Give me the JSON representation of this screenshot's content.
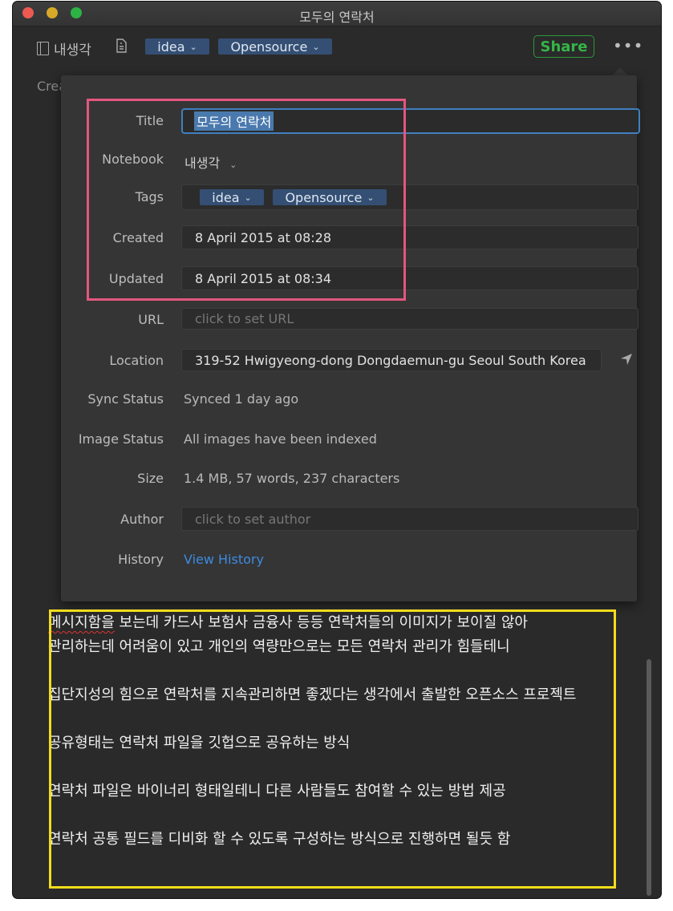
{
  "window": {
    "title": "모두의 연락처"
  },
  "toolbar": {
    "notebook_label": "내생각",
    "tags": [
      {
        "label": "idea"
      },
      {
        "label": "Opensource"
      }
    ],
    "share_label": "Share",
    "more_label": "•••"
  },
  "behind": {
    "created_partial": "Crea"
  },
  "info": {
    "labels": {
      "title": "Title",
      "notebook": "Notebook",
      "tags": "Tags",
      "created": "Created",
      "updated": "Updated",
      "url": "URL",
      "location": "Location",
      "sync_status": "Sync Status",
      "image_status": "Image Status",
      "size": "Size",
      "author": "Author",
      "history": "History"
    },
    "title_value": "모두의 연락처",
    "notebook_value": "내생각",
    "tags": [
      {
        "label": "idea"
      },
      {
        "label": "Opensource"
      }
    ],
    "created_value": "8 April 2015 at 08:28",
    "updated_value": "8 April 2015 at 08:34",
    "url_placeholder": "click to set URL",
    "location_value": "319-52 Hwigyeong-dong Dongdaemun-gu Seoul South Korea",
    "sync_status_value": "Synced 1 day ago",
    "image_status_value": "All images have been indexed",
    "size_value": "1.4 MB, 57 words, 237 characters",
    "author_placeholder": "click to set author",
    "history_link": "View History"
  },
  "note": {
    "p1_first_word": "메시지함을",
    "p1_rest": " 보는데 카드사 보험사 금융사 등등 연락처들의 이미지가 보이질 않아",
    "p1_line2": "관리하는데 어려움이 있고 개인의 역량만으로는 모든 연락처 관리가 힘들테니",
    "p2": "집단지성의 힘으로 연락처를 지속관리하면 좋겠다는 생각에서 출발한 오픈소스 프로젝트",
    "p3": "공유형태는 연락처 파일을 깃헙으로 공유하는 방식",
    "p4": "연락처 파일은 바이너리 형태일테니 다른 사람들도 참여할 수 있는 방법 제공",
    "p5": "연락처 공통 필드를 디비화 할 수 있도록 구성하는 방식으로 진행하면 될듯 함"
  },
  "colors": {
    "highlight_pink": "#e4567f",
    "highlight_yellow": "#f2dc1c",
    "share_green": "#34b547",
    "link_blue": "#3d8be0",
    "tag_bg": "#344f73"
  }
}
